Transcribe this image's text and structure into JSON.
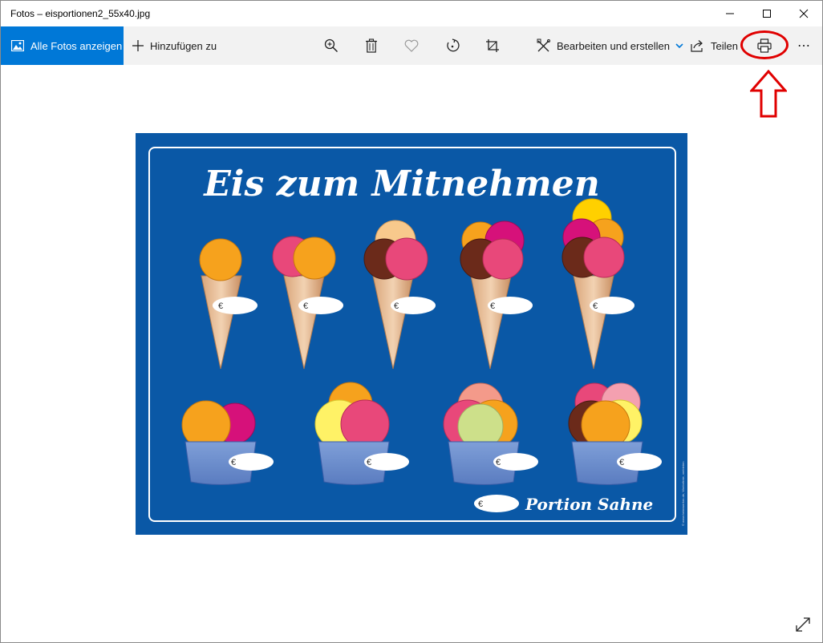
{
  "window": {
    "title": "Fotos – eisportionen2_55x40.jpg"
  },
  "toolbar": {
    "all_photos_label": "Alle Fotos anzeigen",
    "add_to_label": "Hinzufügen zu",
    "edit_create_label": "Bearbeiten und erstellen",
    "share_label": "Teilen",
    "more_label": "⋯",
    "zoom_icon": "zoom-in-icon",
    "delete_icon": "trash-icon",
    "favorite_icon": "heart-icon",
    "rotate_icon": "rotate-icon",
    "crop_icon": "crop-icon",
    "print_icon": "printer-icon"
  },
  "photo": {
    "headline": "Eis zum Mitnehmen",
    "footer_text": "Portion Sahne",
    "currency_symbol": "€",
    "side_text": "© www.heimwerker-de, Werbefreie, verbieten",
    "background_color": "#0a58a6"
  },
  "colors": {
    "accent": "#0078d7",
    "annotation": "#e00000"
  }
}
